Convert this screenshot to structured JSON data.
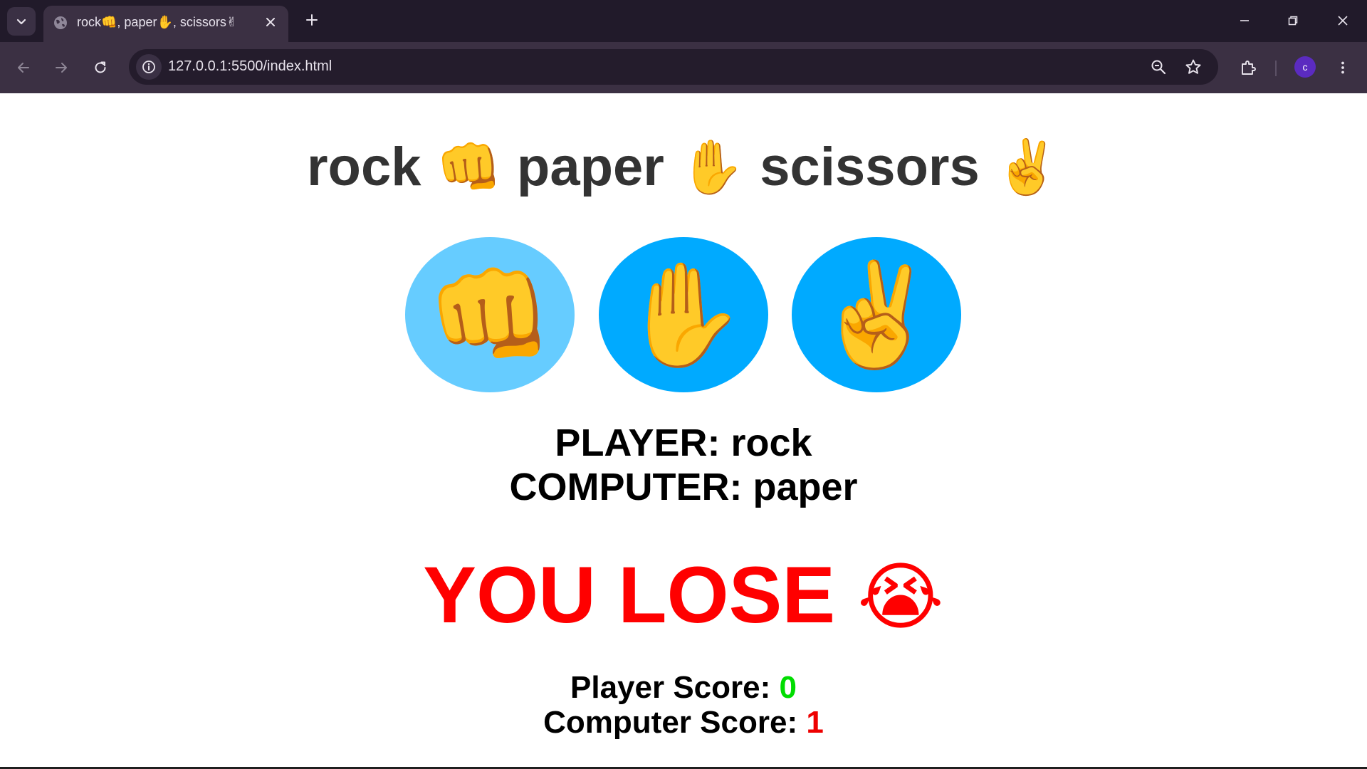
{
  "browser": {
    "tab_title": "rock👊, paper✋, scissors✌",
    "url": "127.0.0.1:5500/index.html",
    "avatar_letter": "c"
  },
  "game": {
    "title_words": [
      "rock",
      "paper",
      "scissors"
    ],
    "title_emojis": [
      "👊",
      "✋",
      "✌️"
    ],
    "choices": [
      {
        "label": "👊",
        "color": "#66ccff"
      },
      {
        "label": "✋",
        "color": "#00aaff"
      },
      {
        "label": "✌️",
        "color": "#00aaff"
      }
    ],
    "player_label": "PLAYER:",
    "player_choice": "rock",
    "computer_label": "COMPUTER:",
    "computer_choice": "paper",
    "verdict_text": "YOU LOSE",
    "verdict_emoji": "😭",
    "verdict_color": "#ff0000",
    "player_score_label": "Player Score:",
    "player_score": "0",
    "player_score_color": "#00dd00",
    "computer_score_label": "Computer Score:",
    "computer_score": "1",
    "computer_score_color": "#ee0000"
  }
}
